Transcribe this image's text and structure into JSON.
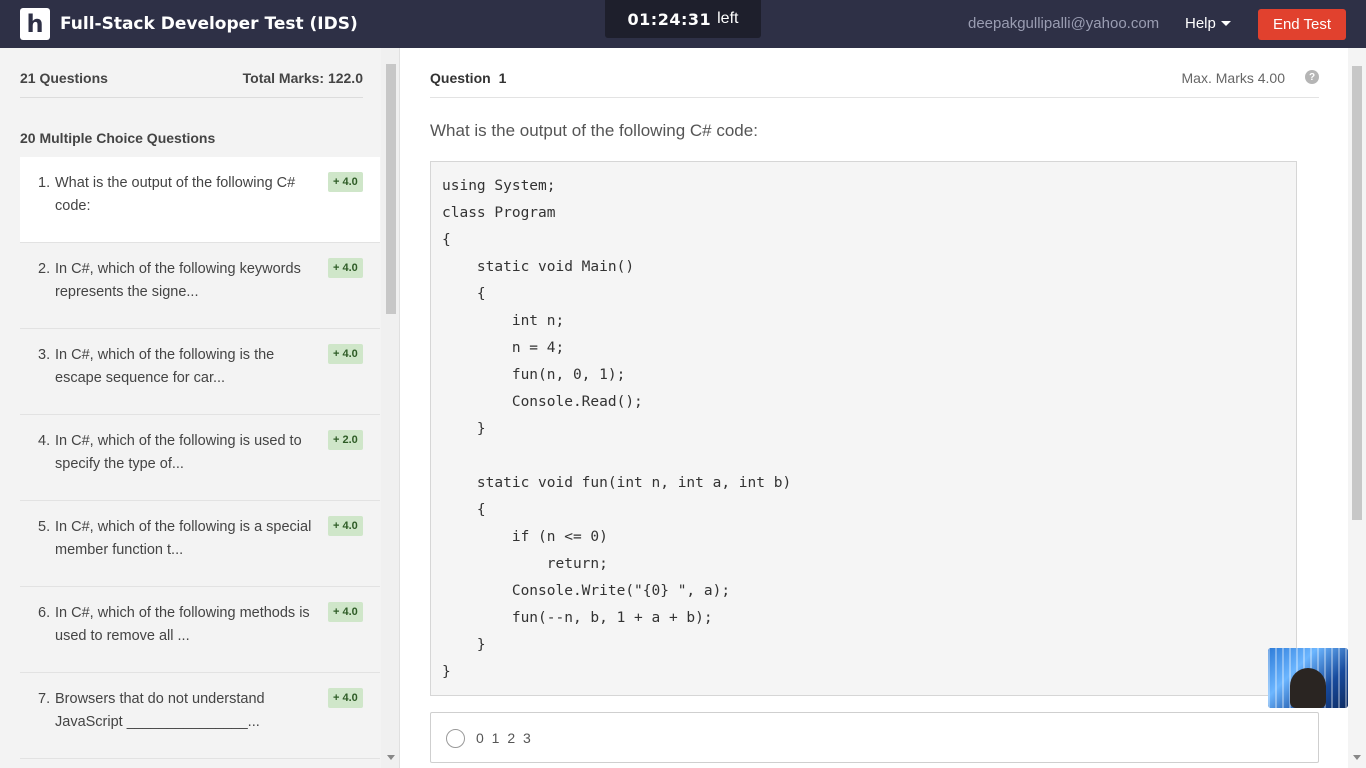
{
  "header": {
    "logo_letter": "h",
    "title": "Full-Stack Developer Test (IDS)",
    "timer": {
      "time": "01:24:31",
      "suffix": "left"
    },
    "user_email": "deepakgullipalli@yahoo.com",
    "help_label": "Help",
    "end_test_label": "End Test"
  },
  "sidebar": {
    "question_count": "21 Questions",
    "total_marks": "Total Marks: 122.0",
    "section_title": "20 Multiple Choice Questions",
    "questions": [
      {
        "num": "1.",
        "text": "What is the output of the following C# code:",
        "marks": "+ 4.0"
      },
      {
        "num": "2.",
        "text": "In C#, which of the following keywords represents the signe...",
        "marks": "+ 4.0"
      },
      {
        "num": "3.",
        "text": "In C#, which of the following is the escape sequence for car...",
        "marks": "+ 4.0"
      },
      {
        "num": "4.",
        "text": "In C#, which of the following is used to specify the type of...",
        "marks": "+ 2.0"
      },
      {
        "num": "5.",
        "text": "In C#, which of the following is a special member function t...",
        "marks": "+ 4.0"
      },
      {
        "num": "6.",
        "text": "In C#, which of the following methods is used to remove all ...",
        "marks": "+ 4.0"
      },
      {
        "num": "7.",
        "text": "Browsers that do not understand JavaScript _______________...",
        "marks": "+ 4.0"
      }
    ]
  },
  "question": {
    "label": "Question",
    "number": "1",
    "max_marks": "Max. Marks 4.00",
    "help_glyph": "?",
    "prompt": "What is the output of the following C# code:",
    "code": "using System;\nclass Program\n{\n    static void Main()\n    {\n        int n;\n        n = 4;\n        fun(n, 0, 1);\n        Console.Read();\n    }\n\n    static void fun(int n, int a, int b)\n    {\n        if (n <= 0)\n            return;\n        Console.Write(\"{0} \", a);\n        fun(--n, b, 1 + a + b);\n    }\n}",
    "options": [
      {
        "text": "0 1 2 3"
      }
    ]
  }
}
